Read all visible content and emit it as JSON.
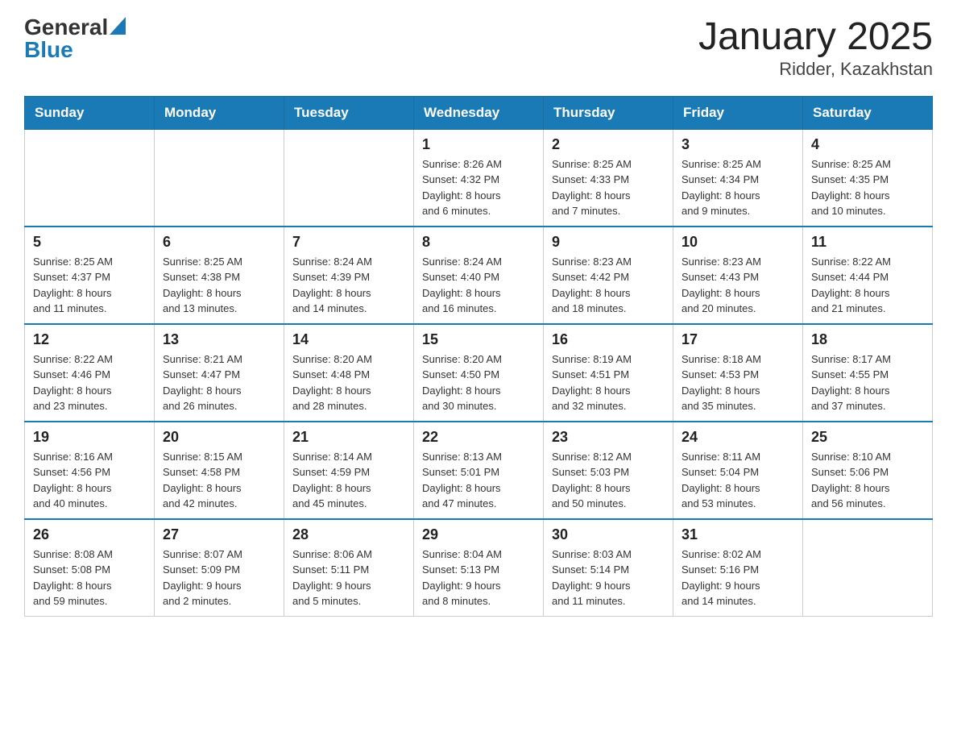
{
  "header": {
    "logo_general": "General",
    "logo_blue": "Blue",
    "title": "January 2025",
    "subtitle": "Ridder, Kazakhstan"
  },
  "weekdays": [
    "Sunday",
    "Monday",
    "Tuesday",
    "Wednesday",
    "Thursday",
    "Friday",
    "Saturday"
  ],
  "weeks": [
    [
      {
        "day": "",
        "info": ""
      },
      {
        "day": "",
        "info": ""
      },
      {
        "day": "",
        "info": ""
      },
      {
        "day": "1",
        "info": "Sunrise: 8:26 AM\nSunset: 4:32 PM\nDaylight: 8 hours\nand 6 minutes."
      },
      {
        "day": "2",
        "info": "Sunrise: 8:25 AM\nSunset: 4:33 PM\nDaylight: 8 hours\nand 7 minutes."
      },
      {
        "day": "3",
        "info": "Sunrise: 8:25 AM\nSunset: 4:34 PM\nDaylight: 8 hours\nand 9 minutes."
      },
      {
        "day": "4",
        "info": "Sunrise: 8:25 AM\nSunset: 4:35 PM\nDaylight: 8 hours\nand 10 minutes."
      }
    ],
    [
      {
        "day": "5",
        "info": "Sunrise: 8:25 AM\nSunset: 4:37 PM\nDaylight: 8 hours\nand 11 minutes."
      },
      {
        "day": "6",
        "info": "Sunrise: 8:25 AM\nSunset: 4:38 PM\nDaylight: 8 hours\nand 13 minutes."
      },
      {
        "day": "7",
        "info": "Sunrise: 8:24 AM\nSunset: 4:39 PM\nDaylight: 8 hours\nand 14 minutes."
      },
      {
        "day": "8",
        "info": "Sunrise: 8:24 AM\nSunset: 4:40 PM\nDaylight: 8 hours\nand 16 minutes."
      },
      {
        "day": "9",
        "info": "Sunrise: 8:23 AM\nSunset: 4:42 PM\nDaylight: 8 hours\nand 18 minutes."
      },
      {
        "day": "10",
        "info": "Sunrise: 8:23 AM\nSunset: 4:43 PM\nDaylight: 8 hours\nand 20 minutes."
      },
      {
        "day": "11",
        "info": "Sunrise: 8:22 AM\nSunset: 4:44 PM\nDaylight: 8 hours\nand 21 minutes."
      }
    ],
    [
      {
        "day": "12",
        "info": "Sunrise: 8:22 AM\nSunset: 4:46 PM\nDaylight: 8 hours\nand 23 minutes."
      },
      {
        "day": "13",
        "info": "Sunrise: 8:21 AM\nSunset: 4:47 PM\nDaylight: 8 hours\nand 26 minutes."
      },
      {
        "day": "14",
        "info": "Sunrise: 8:20 AM\nSunset: 4:48 PM\nDaylight: 8 hours\nand 28 minutes."
      },
      {
        "day": "15",
        "info": "Sunrise: 8:20 AM\nSunset: 4:50 PM\nDaylight: 8 hours\nand 30 minutes."
      },
      {
        "day": "16",
        "info": "Sunrise: 8:19 AM\nSunset: 4:51 PM\nDaylight: 8 hours\nand 32 minutes."
      },
      {
        "day": "17",
        "info": "Sunrise: 8:18 AM\nSunset: 4:53 PM\nDaylight: 8 hours\nand 35 minutes."
      },
      {
        "day": "18",
        "info": "Sunrise: 8:17 AM\nSunset: 4:55 PM\nDaylight: 8 hours\nand 37 minutes."
      }
    ],
    [
      {
        "day": "19",
        "info": "Sunrise: 8:16 AM\nSunset: 4:56 PM\nDaylight: 8 hours\nand 40 minutes."
      },
      {
        "day": "20",
        "info": "Sunrise: 8:15 AM\nSunset: 4:58 PM\nDaylight: 8 hours\nand 42 minutes."
      },
      {
        "day": "21",
        "info": "Sunrise: 8:14 AM\nSunset: 4:59 PM\nDaylight: 8 hours\nand 45 minutes."
      },
      {
        "day": "22",
        "info": "Sunrise: 8:13 AM\nSunset: 5:01 PM\nDaylight: 8 hours\nand 47 minutes."
      },
      {
        "day": "23",
        "info": "Sunrise: 8:12 AM\nSunset: 5:03 PM\nDaylight: 8 hours\nand 50 minutes."
      },
      {
        "day": "24",
        "info": "Sunrise: 8:11 AM\nSunset: 5:04 PM\nDaylight: 8 hours\nand 53 minutes."
      },
      {
        "day": "25",
        "info": "Sunrise: 8:10 AM\nSunset: 5:06 PM\nDaylight: 8 hours\nand 56 minutes."
      }
    ],
    [
      {
        "day": "26",
        "info": "Sunrise: 8:08 AM\nSunset: 5:08 PM\nDaylight: 8 hours\nand 59 minutes."
      },
      {
        "day": "27",
        "info": "Sunrise: 8:07 AM\nSunset: 5:09 PM\nDaylight: 9 hours\nand 2 minutes."
      },
      {
        "day": "28",
        "info": "Sunrise: 8:06 AM\nSunset: 5:11 PM\nDaylight: 9 hours\nand 5 minutes."
      },
      {
        "day": "29",
        "info": "Sunrise: 8:04 AM\nSunset: 5:13 PM\nDaylight: 9 hours\nand 8 minutes."
      },
      {
        "day": "30",
        "info": "Sunrise: 8:03 AM\nSunset: 5:14 PM\nDaylight: 9 hours\nand 11 minutes."
      },
      {
        "day": "31",
        "info": "Sunrise: 8:02 AM\nSunset: 5:16 PM\nDaylight: 9 hours\nand 14 minutes."
      },
      {
        "day": "",
        "info": ""
      }
    ]
  ]
}
